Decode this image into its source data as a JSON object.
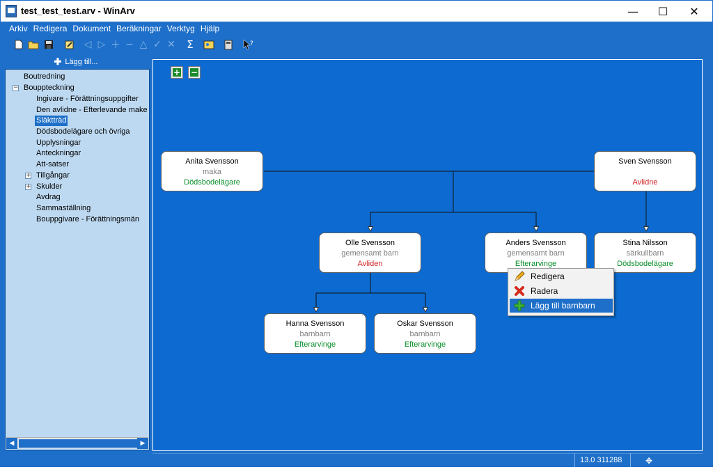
{
  "window": {
    "title": "test_test_test.arv - WinArv",
    "minimize": "—",
    "maximize": "☐",
    "close": "✕"
  },
  "menu": [
    "Arkiv",
    "Redigera",
    "Dokument",
    "Beräkningar",
    "Verktyg",
    "Hjälp"
  ],
  "toolbar": {
    "icons": [
      "new-document-icon",
      "open-folder-icon",
      "save-icon",
      "edit-icon",
      "previous-icon",
      "next-icon",
      "add-icon",
      "remove-icon",
      "up-icon",
      "check-icon",
      "cancel-icon",
      "sum-icon",
      "image-icon",
      "calculator-icon",
      "help-pointer-icon"
    ],
    "sum_glyph": "Σ"
  },
  "sidebar": {
    "add_label": "Lägg till...",
    "items": [
      {
        "label": "Boutredning"
      },
      {
        "label": "Bouppteckning",
        "expander": "−"
      },
      {
        "label": "Ingivare - Förättningsuppgifter"
      },
      {
        "label": "Den avlidne - Efterlevande make"
      },
      {
        "label": "Släktträd",
        "selected": true
      },
      {
        "label": "Dödsbodelägare och övriga"
      },
      {
        "label": "Upplysningar"
      },
      {
        "label": "Anteckningar"
      },
      {
        "label": "Att-satser"
      },
      {
        "label": "Tillgångar",
        "expander": "+"
      },
      {
        "label": "Skulder",
        "expander": "+"
      },
      {
        "label": "Avdrag"
      },
      {
        "label": "Sammaställning"
      },
      {
        "label": "Bouppgivare - Förättningsmän"
      }
    ]
  },
  "tree": {
    "zoom_in": "+",
    "zoom_out": "−",
    "persons": [
      {
        "id": "anita",
        "name": "Anita Svensson",
        "relation": "maka",
        "status": "Dödsbodelägare",
        "status_color": "#0a8f2a"
      },
      {
        "id": "sven",
        "name": "Sven Svensson",
        "relation": "",
        "status": "Avlidne",
        "status_color": "#d22020"
      },
      {
        "id": "olle",
        "name": "Olle Svensson",
        "relation": "gemensamt barn",
        "status": "Avliden",
        "status_color": "#d22020"
      },
      {
        "id": "anders",
        "name": "Anders Svensson",
        "relation": "gemensamt barn",
        "status": "Efterarvinge",
        "status_color": "#0a8f2a"
      },
      {
        "id": "stina",
        "name": "Stina Nilsson",
        "relation": "särkullbarn",
        "status": "Dödsbodelägare",
        "status_color": "#0a8f2a"
      },
      {
        "id": "hanna",
        "name": "Hanna Svensson",
        "relation": "barnbarn",
        "status": "Efterarvinge",
        "status_color": "#0a8f2a"
      },
      {
        "id": "oskar",
        "name": "Oskar Svensson",
        "relation": "barnbarn",
        "status": "Efterarvinge",
        "status_color": "#0a8f2a"
      }
    ]
  },
  "context_menu": {
    "items": [
      {
        "label": "Redigera",
        "icon": "pencil-icon"
      },
      {
        "label": "Radera",
        "icon": "red-x-icon"
      },
      {
        "label": "Lägg till barnbarn",
        "icon": "green-plus-icon",
        "highlighted": true
      }
    ]
  },
  "status": {
    "version": "13.0 311288",
    "icon": "✥"
  },
  "colors": {
    "accent": "#1e6fc9",
    "canvas": "#0d6ad0",
    "sidebar": "#bdd9f1",
    "green": "#0a8f2a",
    "red": "#d22020"
  }
}
